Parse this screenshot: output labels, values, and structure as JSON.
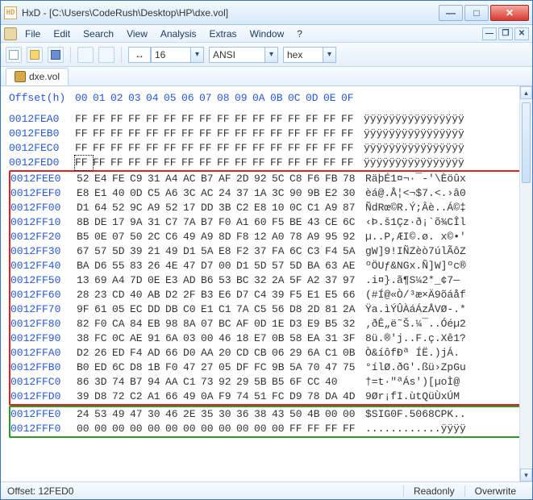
{
  "window": {
    "title": "HxD - [C:\\Users\\CodeRush\\Desktop\\HP\\dxe.vol]"
  },
  "menu": [
    "File",
    "Edit",
    "Search",
    "View",
    "Analysis",
    "Extras",
    "Window",
    "?"
  ],
  "toolbar": {
    "bytes_per_row": "16",
    "charset": "ANSI",
    "radix": "hex"
  },
  "tab": {
    "label": "dxe.vol"
  },
  "hex": {
    "header_label": "Offset(h)",
    "columns": [
      "00",
      "01",
      "02",
      "03",
      "04",
      "05",
      "06",
      "07",
      "08",
      "09",
      "0A",
      "0B",
      "0C",
      "0D",
      "0E",
      "0F"
    ],
    "rows": [
      {
        "ofs": "0012FEA0",
        "b": [
          "FF",
          "FF",
          "FF",
          "FF",
          "FF",
          "FF",
          "FF",
          "FF",
          "FF",
          "FF",
          "FF",
          "FF",
          "FF",
          "FF",
          "FF",
          "FF"
        ],
        "a": "ÿÿÿÿÿÿÿÿÿÿÿÿÿÿÿÿ",
        "grp": "n"
      },
      {
        "ofs": "0012FEB0",
        "b": [
          "FF",
          "FF",
          "FF",
          "FF",
          "FF",
          "FF",
          "FF",
          "FF",
          "FF",
          "FF",
          "FF",
          "FF",
          "FF",
          "FF",
          "FF",
          "FF"
        ],
        "a": "ÿÿÿÿÿÿÿÿÿÿÿÿÿÿÿÿ",
        "grp": "n"
      },
      {
        "ofs": "0012FEC0",
        "b": [
          "FF",
          "FF",
          "FF",
          "FF",
          "FF",
          "FF",
          "FF",
          "FF",
          "FF",
          "FF",
          "FF",
          "FF",
          "FF",
          "FF",
          "FF",
          "FF"
        ],
        "a": "ÿÿÿÿÿÿÿÿÿÿÿÿÿÿÿÿ",
        "grp": "n"
      },
      {
        "ofs": "0012FED0",
        "b": [
          "FF",
          "FF",
          "FF",
          "FF",
          "FF",
          "FF",
          "FF",
          "FF",
          "FF",
          "FF",
          "FF",
          "FF",
          "FF",
          "FF",
          "FF",
          "FF"
        ],
        "a": "ÿÿÿÿÿÿÿÿÿÿÿÿÿÿÿÿ",
        "grp": "n",
        "caret": true
      },
      {
        "ofs": "0012FEE0",
        "b": [
          "52",
          "E4",
          "FE",
          "C9",
          "31",
          "A4",
          "AC",
          "B7",
          "AF",
          "2D",
          "92",
          "5C",
          "C8",
          "F6",
          "FB",
          "78"
        ],
        "a": "RäþÉ1¤¬·¯-'\\Èöûx",
        "grp": "r"
      },
      {
        "ofs": "0012FEF0",
        "b": [
          "E8",
          "E1",
          "40",
          "0D",
          "C5",
          "A6",
          "3C",
          "AC",
          "24",
          "37",
          "1A",
          "3C",
          "90",
          "9B",
          "E2",
          "30"
        ],
        "a": "èá@.Å¦<¬$7.<.›â0",
        "grp": "r"
      },
      {
        "ofs": "0012FF00",
        "b": [
          "D1",
          "64",
          "52",
          "9C",
          "A9",
          "52",
          "17",
          "DD",
          "3B",
          "C2",
          "E8",
          "10",
          "0C",
          "C1",
          "A9",
          "87"
        ],
        "a": "ÑdRœ©R.Ý;Âè..Á©‡",
        "grp": "r"
      },
      {
        "ofs": "0012FF10",
        "b": [
          "8B",
          "DE",
          "17",
          "9A",
          "31",
          "C7",
          "7A",
          "B7",
          "F0",
          "A1",
          "60",
          "F5",
          "BE",
          "43",
          "CE",
          "6C"
        ],
        "a": "‹Þ.š1Çz·ð¡`õ¾CÎl",
        "grp": "r"
      },
      {
        "ofs": "0012FF20",
        "b": [
          "B5",
          "0E",
          "07",
          "50",
          "2C",
          "C6",
          "49",
          "A9",
          "8D",
          "F8",
          "12",
          "A0",
          "78",
          "A9",
          "95",
          "92"
        ],
        "a": "µ..P,ÆI©.ø. x©•'",
        "grp": "r"
      },
      {
        "ofs": "0012FF30",
        "b": [
          "67",
          "57",
          "5D",
          "39",
          "21",
          "49",
          "D1",
          "5A",
          "E8",
          "F2",
          "37",
          "FA",
          "6C",
          "C3",
          "F4",
          "5A"
        ],
        "a": "gW]9!IÑZèò7úlÃôZ",
        "grp": "r"
      },
      {
        "ofs": "0012FF40",
        "b": [
          "BA",
          "D6",
          "55",
          "83",
          "26",
          "4E",
          "47",
          "D7",
          "00",
          "D1",
          "5D",
          "57",
          "5D",
          "BA",
          "63",
          "AE"
        ],
        "a": "ºÖUƒ&NGx.Ñ]W]ºc®",
        "grp": "r"
      },
      {
        "ofs": "0012FF50",
        "b": [
          "13",
          "69",
          "A4",
          "7D",
          "0E",
          "E3",
          "AD",
          "B6",
          "53",
          "BC",
          "32",
          "2A",
          "5F",
          "A2",
          "37",
          "97"
        ],
        "a": ".i¤}.ã­¶S¼2*_¢7—",
        "grp": "r"
      },
      {
        "ofs": "0012FF60",
        "b": [
          "28",
          "23",
          "CD",
          "40",
          "AB",
          "D2",
          "2F",
          "B3",
          "E6",
          "D7",
          "C4",
          "39",
          "F5",
          "E1",
          "E5",
          "66"
        ],
        "a": "(#Í@«Ò/³æ×Ä9õáåf",
        "grp": "r"
      },
      {
        "ofs": "0012FF70",
        "b": [
          "9F",
          "61",
          "05",
          "EC",
          "DD",
          "DB",
          "C0",
          "E1",
          "C1",
          "7A",
          "C5",
          "56",
          "D8",
          "2D",
          "81",
          "2A"
        ],
        "a": "Ÿa.ìÝÛÀáÁzÅVØ-.*",
        "grp": "r"
      },
      {
        "ofs": "0012FF80",
        "b": [
          "82",
          "F0",
          "CA",
          "84",
          "EB",
          "98",
          "8A",
          "07",
          "BC",
          "AF",
          "0D",
          "1E",
          "D3",
          "E9",
          "B5",
          "32"
        ],
        "a": "‚ðÊ„ë˜Š.¼¯..Óéµ2",
        "grp": "r"
      },
      {
        "ofs": "0012FF90",
        "b": [
          "38",
          "FC",
          "0C",
          "AE",
          "91",
          "6A",
          "03",
          "00",
          "46",
          "18",
          "E7",
          "0B",
          "58",
          "EA",
          "31",
          "3F"
        ],
        "a": "8ü.®'j..F.ç.Xê1?",
        "grp": "r"
      },
      {
        "ofs": "0012FFA0",
        "b": [
          "D2",
          "26",
          "ED",
          "F4",
          "AD",
          "66",
          "D0",
          "AA",
          "20",
          "CD",
          "CB",
          "06",
          "29",
          "6A",
          "C1",
          "0B"
        ],
        "a": "Ò&íô­fÐª ÍË.)jÁ.",
        "grp": "r"
      },
      {
        "ofs": "0012FFB0",
        "b": [
          "B0",
          "ED",
          "6C",
          "D8",
          "1B",
          "F0",
          "47",
          "27",
          "05",
          "DF",
          "FC",
          "9B",
          "5A",
          "70",
          "47",
          "75"
        ],
        "a": "°ílØ.ðG'.ßü›ZpGu",
        "grp": "r"
      },
      {
        "ofs": "0012FFC0",
        "b": [
          "86",
          "3D",
          "74",
          "B7",
          "94",
          "AA",
          "C1",
          "73",
          "92",
          "29",
          "5B",
          "B5",
          "6F",
          "CC",
          "40",
          " "
        ],
        "a": "†=t·\"ªÁs')[µoÌ@",
        "grp": "r"
      },
      {
        "ofs": "0012FFD0",
        "b": [
          "39",
          "D8",
          "72",
          "C2",
          "A1",
          "66",
          "49",
          "0A",
          "F9",
          "74",
          "51",
          "FC",
          "D9",
          "78",
          "DA",
          "4D"
        ],
        "a": "9Ør¡fI.ùtQüÙxÚM",
        "grp": "r"
      },
      {
        "ofs": "0012FFE0",
        "b": [
          "24",
          "53",
          "49",
          "47",
          "30",
          "46",
          "2E",
          "35",
          "30",
          "36",
          "38",
          "43",
          "50",
          "4B",
          "00",
          "00"
        ],
        "a": "$SIG0F.5068CPK..",
        "grp": "g"
      },
      {
        "ofs": "0012FFF0",
        "b": [
          "00",
          "00",
          "00",
          "00",
          "00",
          "00",
          "00",
          "00",
          "00",
          "00",
          "00",
          "00",
          "FF",
          "FF",
          "FF",
          "FF"
        ],
        "a": "............ÿÿÿÿ",
        "grp": "g"
      }
    ]
  },
  "status": {
    "offset_label": "Offset: 12FED0",
    "mode": "Readonly",
    "overwrite": "Overwrite"
  }
}
